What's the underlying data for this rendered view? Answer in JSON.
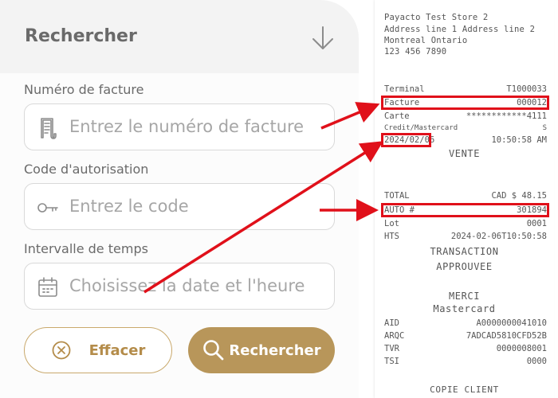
{
  "search": {
    "title": "Rechercher",
    "invoice": {
      "label": "Numéro de facture",
      "placeholder": "Entrez le numéro de facture"
    },
    "auth": {
      "label": "Code d'autorisation",
      "placeholder": "Entrez le code"
    },
    "time": {
      "label": "Intervalle de temps",
      "placeholder": "Choisissez la date et l'heure"
    },
    "clear_label": "Effacer",
    "search_label": "Rechercher"
  },
  "receipt": {
    "store_name": "Payacto Test Store 2",
    "address": "Address line 1 Address line 2",
    "city": "Montreal Ontario",
    "phone": "123 456 7890",
    "terminal_label": "Terminal",
    "terminal_value": "T1000033",
    "invoice_label": "Facture",
    "invoice_value": "000012",
    "card_label": "Carte",
    "card_value": "************4111",
    "card_type": "Credit/Mastercard",
    "card_type_code": "S",
    "date": "2024/02/06",
    "time": "10:50:58 AM",
    "sale": "VENTE",
    "total_label": "TOTAL",
    "total_value": "CAD $ 48.15",
    "auth_label": "AUTO #",
    "auth_value": "301894",
    "lot_label": "Lot",
    "lot_value": "0001",
    "hts_label": "HTS",
    "hts_value": "2024-02-06T10:50:58",
    "status_1": "TRANSACTION",
    "status_2": "APPROUVEE",
    "thanks": "MERCI",
    "brand": "Mastercard",
    "aid_label": "AID",
    "aid_value": "A0000000041010",
    "arqc_label": "ARQC",
    "arqc_value": "7ADCAD5810CFD52B",
    "tvr_label": "TVR",
    "tvr_value": "0000008001",
    "tsi_label": "TSI",
    "tsi_value": "0000",
    "copy": "COPIE CLIENT"
  },
  "colors": {
    "accent": "#b8965a",
    "highlight": "#e0101a",
    "text": "#6a6a6a"
  },
  "icons": {
    "header": "arrow-down-icon",
    "invoice": "receipt-icon",
    "auth": "key-icon",
    "time": "calendar-icon",
    "clear": "close-circle-icon",
    "search": "search-icon"
  }
}
